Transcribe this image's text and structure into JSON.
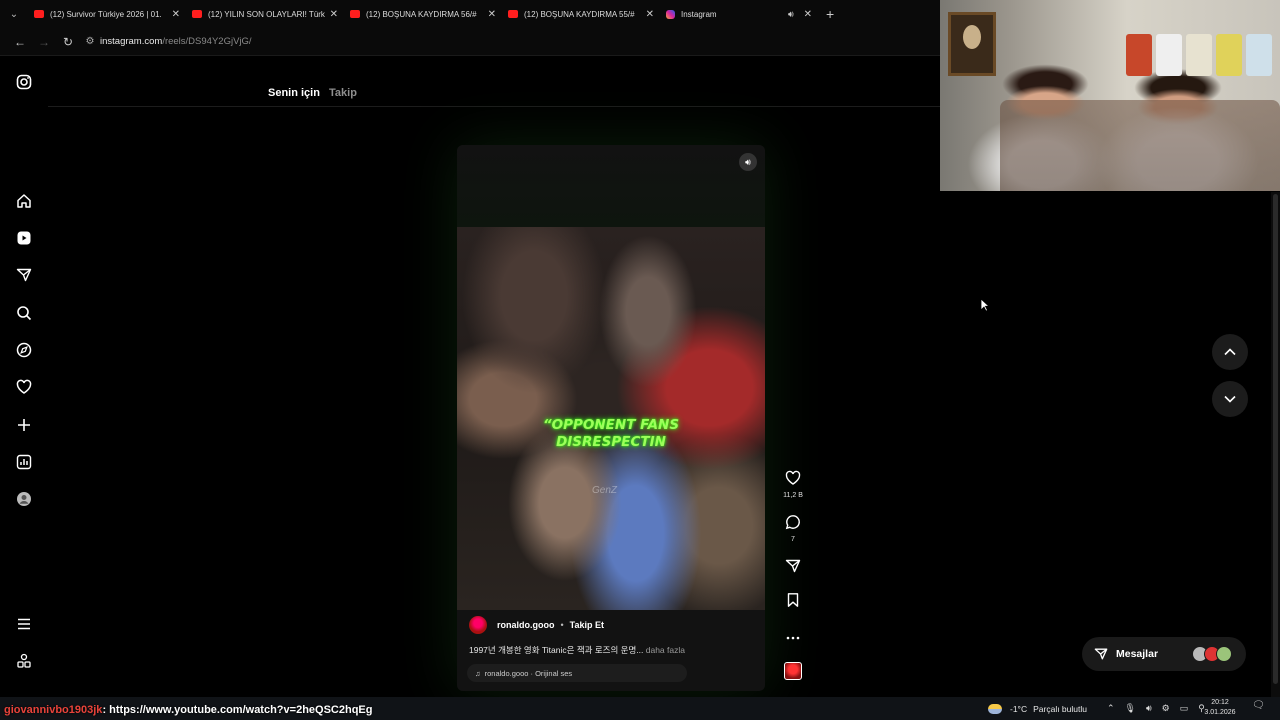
{
  "browser": {
    "tabs": [
      {
        "title": "(12) Survivor Türkiye 2026 | 01.",
        "icon": "youtube-icon"
      },
      {
        "title": "(12) YILIN SON OLAYLARI! Türk",
        "icon": "youtube-icon"
      },
      {
        "title": "(12) BOŞUNA KAYDIRMA 56/#",
        "icon": "youtube-icon"
      },
      {
        "title": "(12) BOŞUNA KAYDIRMA 55/#",
        "icon": "youtube-icon"
      },
      {
        "title": "Instagram",
        "icon": "instagram-icon"
      }
    ],
    "url_host": "instagram.com",
    "url_path": "/reels/DS94Y2GjVjG/"
  },
  "feed_tabs": {
    "for_you": "Senin için",
    "following": "Takip"
  },
  "reel": {
    "overlay_line1": "“OPPONENT FANS",
    "overlay_line2": "DISRESPECTIN",
    "watermark": "GenZ",
    "username": "ronaldo.gooo",
    "separator": "•",
    "follow": "Takip Et",
    "caption": "1997년 개봉한 영화 Titanic은 잭과 로즈의 운명...",
    "caption_more": "daha fazla",
    "audio": "ronaldo.gooo · Orijinal ses"
  },
  "actions": {
    "likes": "11,2 B",
    "comments": "7"
  },
  "messages": {
    "label": "Mesajlar"
  },
  "taskbar": {
    "chat_user": "giovannivbo1903jk",
    "chat_text": ": https://www.youtube.com/watch?v=2heQSC2hqEg",
    "temperature": "-1°C",
    "weather": "Parçalı bulutlu",
    "time": "20:12",
    "date": "3.01.2026"
  },
  "colors": {
    "overlay_green": "#9cff5a",
    "youtube_red": "#ff1e1e"
  }
}
